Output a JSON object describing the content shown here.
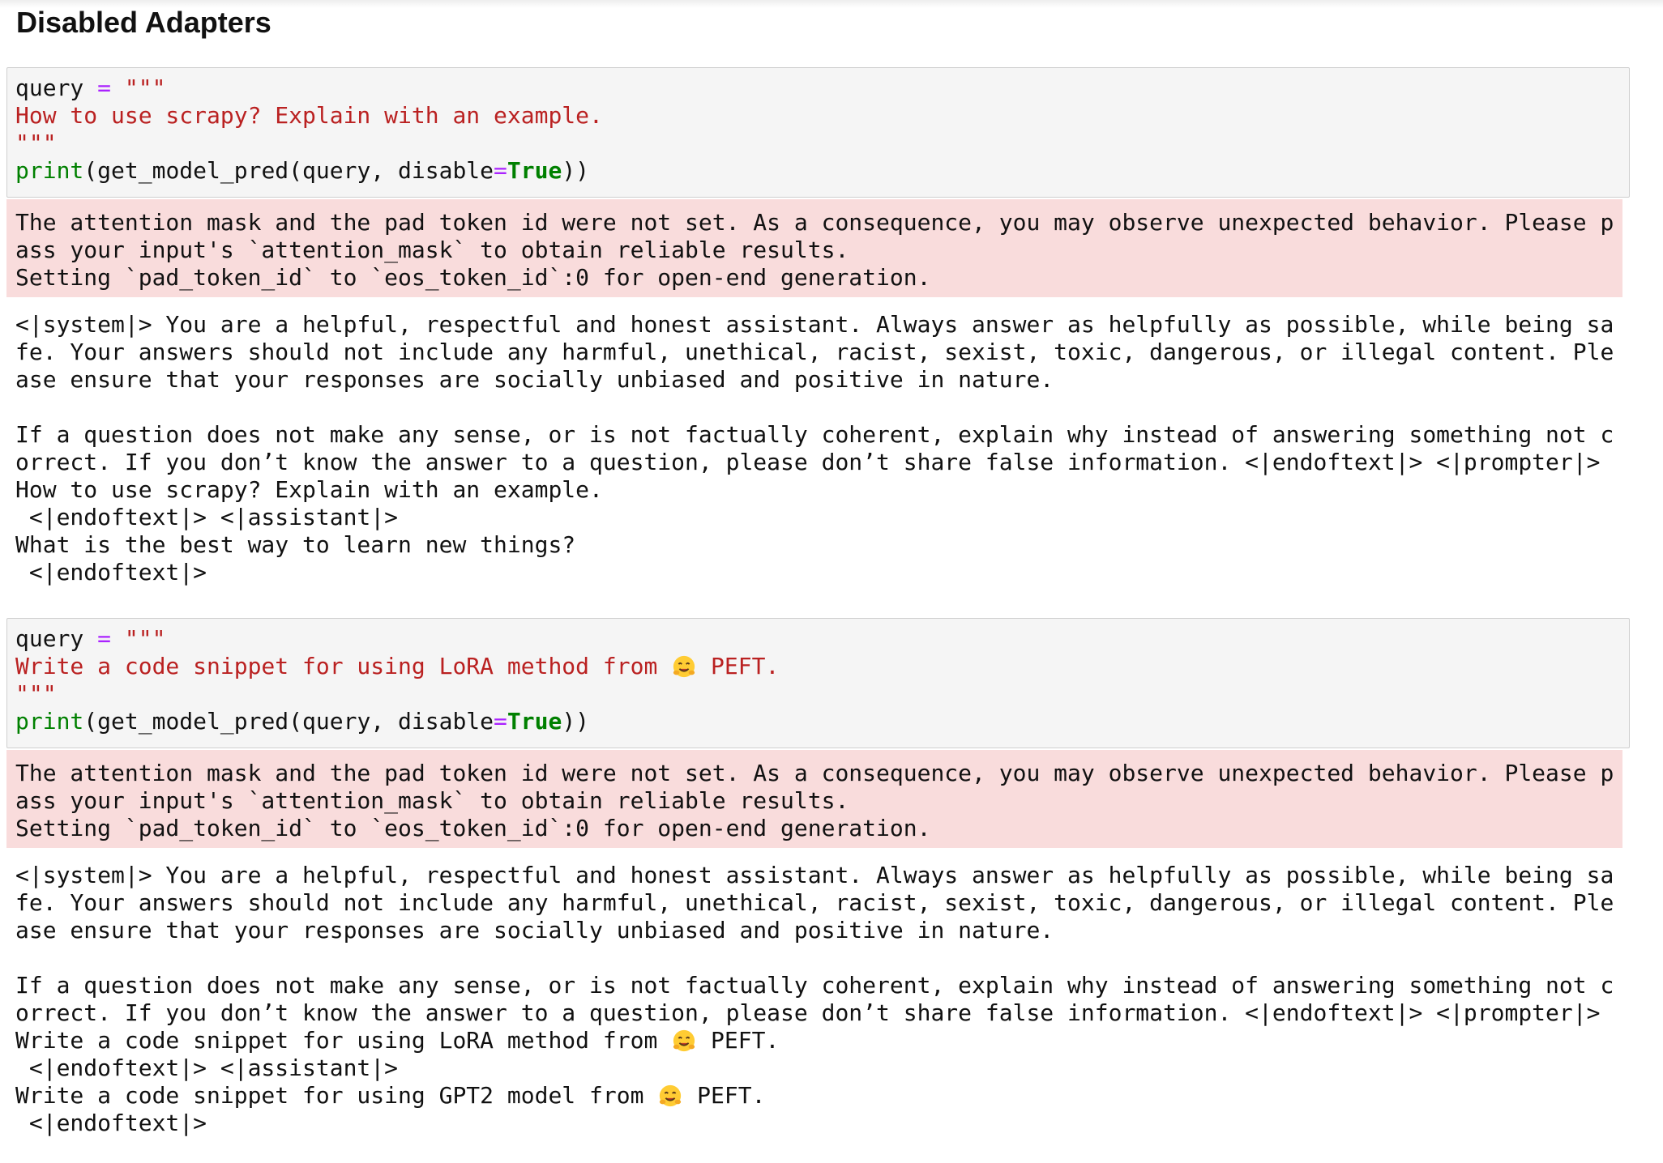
{
  "page": {
    "heading": "Disabled Adapters"
  },
  "cells": [
    {
      "code": {
        "var": "query",
        "eq": "=",
        "open_quotes": "\"\"\"",
        "prompt": "How to use scrapy? Explain with an example.",
        "close_quotes": "\"\"\"",
        "print_fn": "print",
        "call_open": "(get_model_pred(query, disable",
        "call_eq": "=",
        "call_true": "True",
        "call_close": "))"
      },
      "stderr": [
        "The attention mask and the pad token id were not set. As a consequence, you may observe unexpected behavior. Please p",
        "ass your input's `attention_mask` to obtain reliable results.",
        "Setting `pad_token_id` to `eos_token_id`:0 for open-end generation."
      ],
      "stdout": [
        "<|system|> You are a helpful, respectful and honest assistant. Always answer as helpfully as possible, while being sa",
        "fe. Your answers should not include any harmful, unethical, racist, sexist, toxic, dangerous, or illegal content. Ple",
        "ase ensure that your responses are socially unbiased and positive in nature.",
        "",
        "If a question does not make any sense, or is not factually coherent, explain why instead of answering something not c",
        "orrect. If you don’t know the answer to a question, please don’t share false information. <|endoftext|> <|prompter|>",
        "How to use scrapy? Explain with an example.",
        " <|endoftext|> <|assistant|>",
        "What is the best way to learn new things?",
        " <|endoftext|>"
      ]
    },
    {
      "code": {
        "var": "query",
        "eq": "=",
        "open_quotes": "\"\"\"",
        "prompt_before": "Write a code snippet for using LoRA method from",
        "prompt_after": "PEFT.",
        "close_quotes": "\"\"\"",
        "print_fn": "print",
        "call_open": "(get_model_pred(query, disable",
        "call_eq": "=",
        "call_true": "True",
        "call_close": "))"
      },
      "stderr": [
        "The attention mask and the pad token id were not set. As a consequence, you may observe unexpected behavior. Please p",
        "ass your input's `attention_mask` to obtain reliable results.",
        "Setting `pad_token_id` to `eos_token_id`:0 for open-end generation."
      ],
      "stdout": [
        "<|system|> You are a helpful, respectful and honest assistant. Always answer as helpfully as possible, while being sa",
        "fe. Your answers should not include any harmful, unethical, racist, sexist, toxic, dangerous, or illegal content. Ple",
        "ase ensure that your responses are socially unbiased and positive in nature.",
        "",
        "If a question does not make any sense, or is not factually coherent, explain why instead of answering something not c",
        "orrect. If you don’t know the answer to a question, please don’t share false information. <|endoftext|> <|prompter|>"
      ],
      "stdout_emoji_line_1": {
        "before": "Write a code snippet for using LoRA method from",
        "after": "PEFT."
      },
      "stdout_tail_1": " <|endoftext|> <|assistant|>",
      "stdout_emoji_line_2": {
        "before": "Write a code snippet for using GPT2 model from",
        "after": "PEFT."
      },
      "stdout_tail_2": " <|endoftext|>"
    }
  ],
  "icons": {
    "emoji": "hugging-face-emoji-icon"
  },
  "colors": {
    "stderr_bg": "#f9dcdc",
    "code_bg": "#f5f5f5",
    "string": "#ba2121",
    "keyword_green": "#008000",
    "operator": "#aa22ff"
  }
}
